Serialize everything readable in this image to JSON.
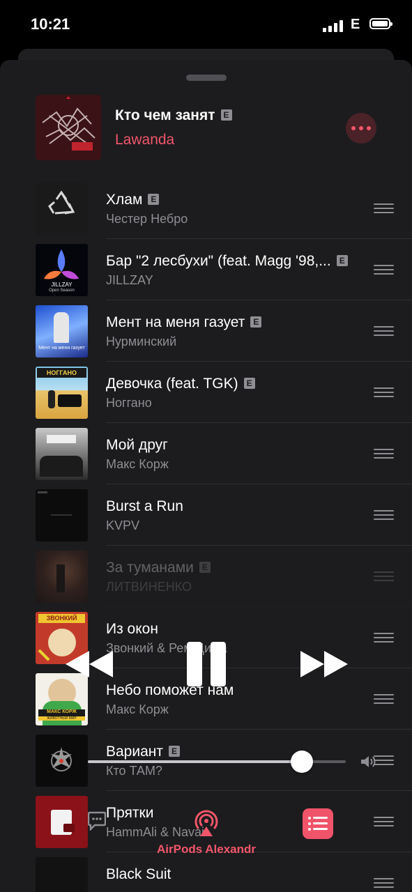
{
  "status_bar": {
    "time": "10:21",
    "network": "E"
  },
  "now_playing": {
    "title": "Кто чем занят",
    "explicit": "E",
    "artist": "Lawanda"
  },
  "tracks": [
    {
      "title": "Хлам",
      "artist": "Честер Небро",
      "explicit": "E"
    },
    {
      "title": "Бар \"2 лесбухи\" (feat. Magg '98,...",
      "artist": "JILLZAY",
      "explicit": "E",
      "art_text": "JILLZAY",
      "art_subtext": "Open Season"
    },
    {
      "title": "Мент на меня газует",
      "artist": "Нурминский",
      "explicit": "E",
      "art_text": "Мент на меня газует"
    },
    {
      "title": "Девочка (feat. TGK)",
      "artist": "Ноггано",
      "explicit": "E",
      "art_text": "НОГГАНО"
    },
    {
      "title": "Мой друг",
      "artist": "Макс Корж"
    },
    {
      "title": "Burst a Run",
      "artist": "KVPV"
    },
    {
      "title": "За туманами",
      "artist": "ЛИТВИНЕНКО",
      "explicit": "E"
    },
    {
      "title": "Из окон",
      "artist": "Звонкий & Рем Дигга",
      "art_text": "ЗВОНКИЙ"
    },
    {
      "title": "Небо поможет нам",
      "artist": "Макс Корж",
      "art_text": "МАКС КОРЖ",
      "art_subtext": "ЖИВОТНЫЙ МИР"
    },
    {
      "title": "Вариант",
      "artist": "Кто ТАМ?",
      "explicit": "E"
    },
    {
      "title": "Прятки",
      "artist": "HammAli & Navai"
    },
    {
      "title": "Black Suit",
      "artist": ""
    }
  ],
  "playback": {
    "volume": 0.83
  },
  "airplay": {
    "device": "AirPods Alexandr"
  },
  "colors": {
    "accent": "#f2566b",
    "sheet": "#1c1c1e",
    "secondary_text": "#8e8e93"
  }
}
